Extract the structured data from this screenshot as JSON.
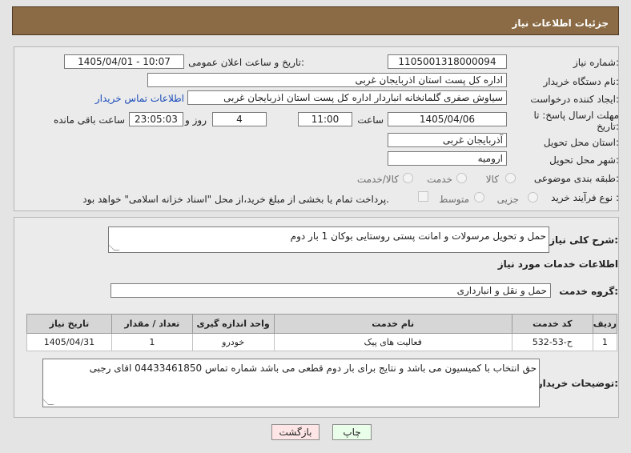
{
  "header": {
    "title": "جزئیات اطلاعات نیاز"
  },
  "form": {
    "need_number_label": "شماره نیاز:",
    "need_number": "1105001318000094",
    "announce_label": "تاریخ و ساعت اعلان عمومی:",
    "announce_value": "1405/04/01 - 10:07",
    "buyer_org_label": "نام دستگاه خریدار:",
    "buyer_org": "اداره کل پست استان اذربایجان غربی",
    "creator_label": "ایجاد کننده درخواست:",
    "creator": "سیاوش صفری گلمانخانه انباردار اداره کل پست استان اذربایجان غربی",
    "contact_link": "اطلاعات تماس خریدار",
    "deadline_label": "مهلت ارسال پاسخ: تا تاریخ:",
    "deadline_date": "1405/04/06",
    "time_label": "ساعت",
    "deadline_time": "11:00",
    "days_value": "4",
    "days_label": "روز و",
    "remaining_time": "23:05:03",
    "remaining_label": "ساعت باقی مانده",
    "province_label": "استان محل تحویل:",
    "province": "آذربایجان غربی",
    "city_label": "شهر محل تحویل:",
    "city": "ارومیه",
    "category_label": "طبقه بندی موضوعی:",
    "category_options": [
      "کالا",
      "خدمت",
      "کالا/خدمت"
    ],
    "process_label": "نوع فرآیند خرید :",
    "process_options": [
      "جزیی",
      "متوسط"
    ],
    "payment_note": "پرداخت تمام یا بخشی از مبلغ خرید،از محل \"اسناد خزانه اسلامی\" خواهد بود."
  },
  "details": {
    "summary_label": "شرح کلی نیاز:",
    "summary": "حمل و تحویل مرسولات و امانت پستی روستایی بوکان 1 بار دوم",
    "services_title": "اطلاعات خدمات مورد نیاز",
    "service_group_label": "گروه خدمت:",
    "service_group": "حمل و نقل و انبارداری",
    "table": {
      "headers": [
        "ردیف",
        "کد خدمت",
        "نام خدمت",
        "واحد اندازه گیری",
        "تعداد / مقدار",
        "تاریخ نیاز"
      ],
      "rows": [
        [
          "1",
          "ح-53-532",
          "فعالیت های پیک",
          "خودرو",
          "1",
          "1405/04/31"
        ]
      ]
    },
    "buyer_notes_label": "توضیحات خریدار:",
    "buyer_notes": "حق انتخاب با کمیسیون می باشد و نتایج برای بار دوم قطعی می باشد شماره تماس 04433461850 اقای رجبی"
  },
  "buttons": {
    "print": "چاپ",
    "back": "بازگشت"
  },
  "colors": {
    "header_bg": "#8a6b45",
    "link": "#1a4bb8",
    "print_bg": "#eaffea",
    "back_bg": "#ffe6e6"
  }
}
